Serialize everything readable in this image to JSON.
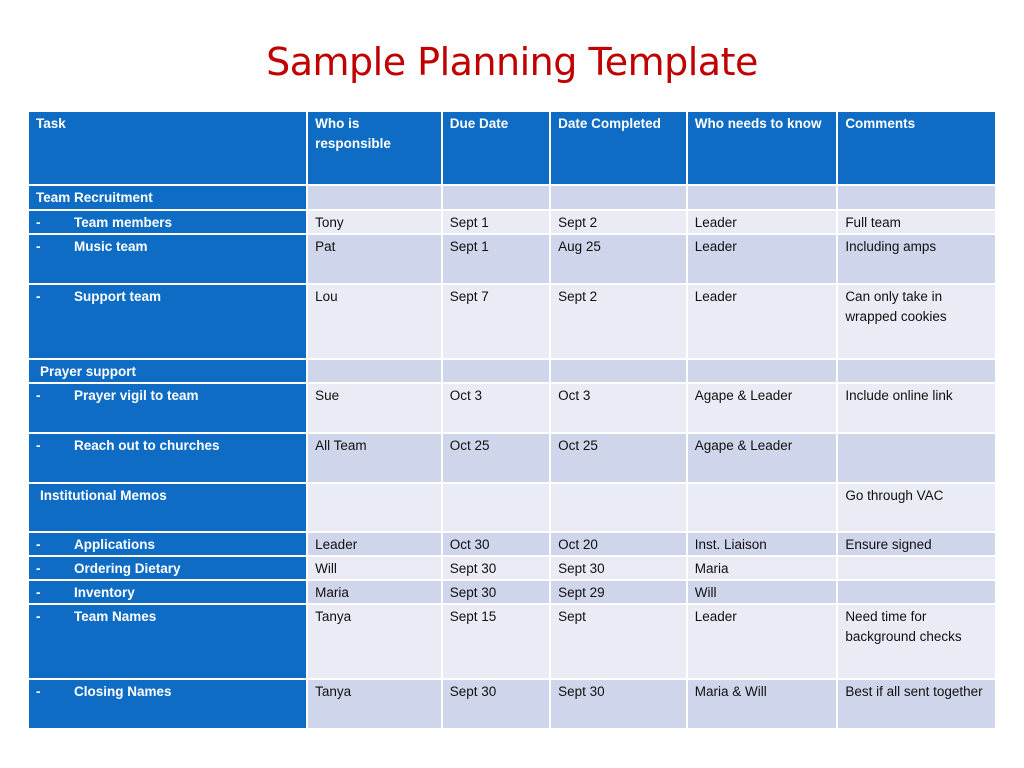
{
  "title": "Sample Planning Template",
  "columns": [
    "Task",
    "Who is responsible",
    "Due Date",
    "Date Completed",
    "Who needs to know",
    "Comments"
  ],
  "colors": {
    "title": "#c00000",
    "header_bg": "#0e6cc4",
    "row_dark": "#cfd5ea",
    "row_light": "#e9ebf5"
  },
  "rows": [
    {
      "type": "section",
      "task": "Team Recruitment",
      "who": "",
      "due": "",
      "completed": "",
      "notify": "",
      "comments": ""
    },
    {
      "type": "item",
      "dash": "-",
      "task": "Team members",
      "who": "Tony",
      "due": "Sept 1",
      "completed": "Sept 2",
      "notify": "Leader",
      "comments": "Full team"
    },
    {
      "type": "item",
      "dash": "-",
      "task": "Music team",
      "who": "Pat",
      "due": "Sept 1",
      "completed": "Aug 25",
      "notify": "Leader",
      "comments": "Including amps"
    },
    {
      "type": "item",
      "dash": "-",
      "task": "Support team",
      "who": "Lou",
      "due": "Sept 7",
      "completed": "Sept 2",
      "notify": "Leader",
      "comments": "Can only take in wrapped cookies"
    },
    {
      "type": "section",
      "task": "Prayer support",
      "who": "",
      "due": "",
      "completed": "",
      "notify": "",
      "comments": ""
    },
    {
      "type": "item",
      "dash": "-",
      "task": "Prayer vigil to team",
      "who": "Sue",
      "due": "Oct 3",
      "completed": "Oct 3",
      "notify": "Agape & Leader",
      "comments": "Include online link"
    },
    {
      "type": "item",
      "dash": "-",
      "task": "Reach out to churches",
      "who": "All Team",
      "due": "Oct 25",
      "completed": "Oct 25",
      "notify": "Agape & Leader",
      "comments": ""
    },
    {
      "type": "section",
      "task": "Institutional Memos",
      "who": "",
      "due": "",
      "completed": "",
      "notify": "",
      "comments": "Go through VAC"
    },
    {
      "type": "item",
      "dash": "-",
      "task": "Applications",
      "who": "Leader",
      "due": "Oct 30",
      "completed": "Oct 20",
      "notify": "Inst. Liaison",
      "comments": "Ensure signed"
    },
    {
      "type": "item",
      "dash": "-",
      "task": "Ordering Dietary",
      "who": "Will",
      "due": "Sept 30",
      "completed": "Sept 30",
      "notify": "Maria",
      "comments": ""
    },
    {
      "type": "item",
      "dash": "-",
      "task": "Inventory",
      "who": "Maria",
      "due": "Sept 30",
      "completed": "Sept 29",
      "notify": "Will",
      "comments": ""
    },
    {
      "type": "item",
      "dash": "-",
      "task": "Team Names",
      "who": "Tanya",
      "due": "Sept 15",
      "completed": "Sept",
      "notify": "Leader",
      "comments": "Need time for background checks"
    },
    {
      "type": "item",
      "dash": "-",
      "task": "Closing Names",
      "who": "Tanya",
      "due": "Sept 30",
      "completed": "Sept 30",
      "notify": "Maria & Will",
      "comments": "Best if all sent together"
    }
  ]
}
